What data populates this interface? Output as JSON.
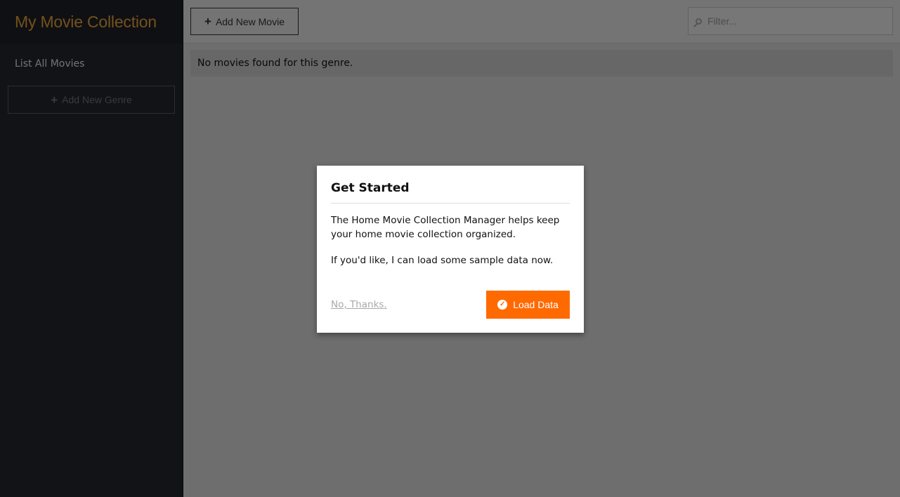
{
  "sidebar": {
    "title": "My Movie Collection",
    "nav_items": [
      {
        "label": "List All Movies"
      }
    ],
    "add_genre_label": "Add New Genre"
  },
  "toolbar": {
    "add_movie_label": "Add New Movie",
    "filter_placeholder": "Filter..."
  },
  "main": {
    "empty_message": "No movies found for this genre."
  },
  "modal": {
    "title": "Get Started",
    "paragraph1": "The Home Movie Collection Manager helps keep your home movie collection organized.",
    "paragraph2": "If you'd like, I can load some sample data now.",
    "decline_label": "No, Thanks.",
    "confirm_label": "Load Data"
  },
  "colors": {
    "title_accent": "#e8a33b",
    "primary_button": "#ff6a00",
    "sidebar_bg": "#24272e"
  },
  "icons": {
    "add_genre": "plus-icon",
    "add_movie": "plus-icon",
    "filter": "search-icon",
    "load_data": "check-circle-icon"
  }
}
